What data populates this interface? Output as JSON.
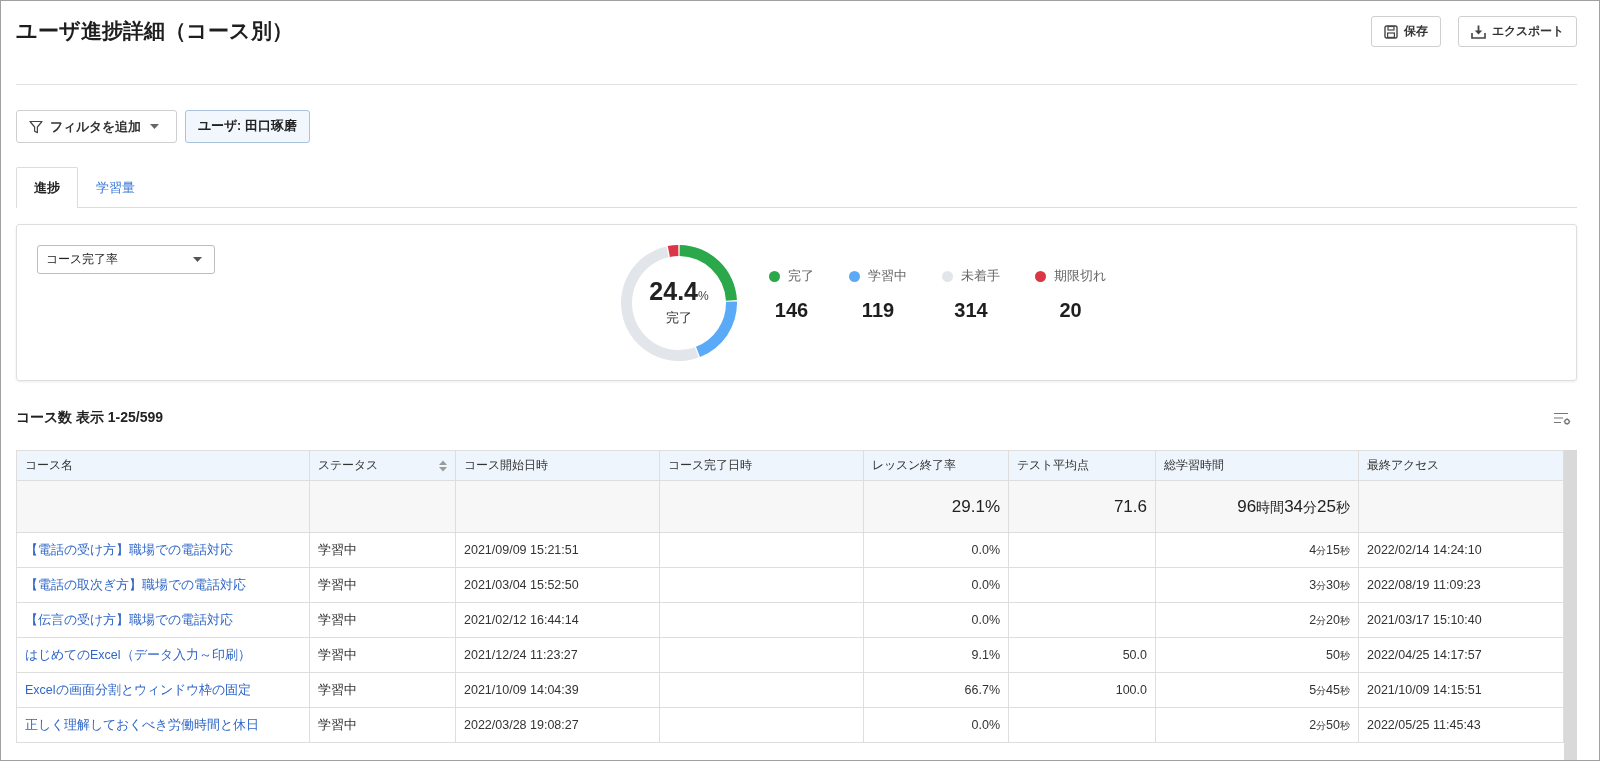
{
  "page": {
    "title": "ユーザ進捗詳細（コース別）",
    "actions": [
      {
        "label": "保存",
        "kind": "save"
      },
      {
        "label": "エクスポート",
        "kind": "export"
      }
    ]
  },
  "filters": {
    "add_filter": {
      "label": "フィルタを追加"
    },
    "chips": [
      {
        "label": "ユーザ: 田口琢磨"
      }
    ]
  },
  "tabs": [
    {
      "label": "進捗",
      "selected": true
    },
    {
      "label": "学習量",
      "selected": false
    }
  ],
  "summary": {
    "metric_select": {
      "value": "コース完了率"
    },
    "center": {
      "value": "24.4%",
      "label": "完了"
    },
    "chart_data": {
      "type": "donut",
      "values": [
        24.4,
        19.9,
        52.4,
        3.3
      ]
    },
    "legend": [
      {
        "label": "完了",
        "count": "146",
        "color": "#2aa84a"
      },
      {
        "label": "学習中",
        "count": "119",
        "color": "#5aaaf8"
      },
      {
        "label": "未着手",
        "count": "314",
        "color": "#e2e5ea"
      },
      {
        "label": "期限切れ",
        "count": "20",
        "color": "#dc3545"
      }
    ]
  },
  "table": {
    "title": "コース数 表示 1-25/599",
    "columns": [
      {
        "label": "コース名",
        "sortable": false
      },
      {
        "label": "ステータス",
        "sortable": true
      },
      {
        "label": "コース開始日時",
        "sortable": false
      },
      {
        "label": "コース完了日時",
        "sortable": false
      },
      {
        "label": "レッスン終了率",
        "sortable": false
      },
      {
        "label": "テスト平均点",
        "sortable": false
      },
      {
        "label": "総学習時間",
        "sortable": false
      },
      {
        "label": "最終アクセス",
        "sortable": false
      }
    ],
    "summary_row": {
      "lesson_rate": "29.1%",
      "test_avg": "71.6",
      "total_time": "96時間34分25秒"
    },
    "rows": [
      {
        "course": "【電話の受け方】職場での電話対応",
        "status": "学習中",
        "started": "2021/09/09 15:21:51",
        "lesson_rate": "0.0%",
        "total_time": "4分15秒",
        "last_access": "2022/02/14 14:24:10"
      },
      {
        "course": "【電話の取次ぎ方】職場での電話対応",
        "status": "学習中",
        "started": "2021/03/04 15:52:50",
        "lesson_rate": "0.0%",
        "total_time": "3分30秒",
        "last_access": "2022/08/19 11:09:23"
      },
      {
        "course": "【伝言の受け方】職場での電話対応",
        "status": "学習中",
        "started": "2021/02/12 16:44:14",
        "lesson_rate": "0.0%",
        "total_time": "2分20秒",
        "last_access": "2021/03/17 15:10:40"
      },
      {
        "course": "はじめてのExcel（データ入力～印刷）",
        "status": "学習中",
        "started": "2021/12/24 11:23:27",
        "lesson_rate": "9.1%",
        "test_avg": "50.0",
        "total_time": "50秒",
        "last_access": "2022/04/25 14:17:57"
      },
      {
        "course": "Excelの画面分割とウィンドウ枠の固定",
        "status": "学習中",
        "started": "2021/10/09 14:04:39",
        "lesson_rate": "66.7%",
        "test_avg": "100.0",
        "total_time": "5分45秒",
        "last_access": "2021/10/09 14:15:51"
      },
      {
        "course": "正しく理解しておくべき労働時間と休日",
        "status": "学習中",
        "started": "2022/03/28 19:08:27",
        "lesson_rate": "0.0%",
        "total_time": "2分50秒",
        "last_access": "2022/05/25 11:45:43"
      }
    ]
  }
}
